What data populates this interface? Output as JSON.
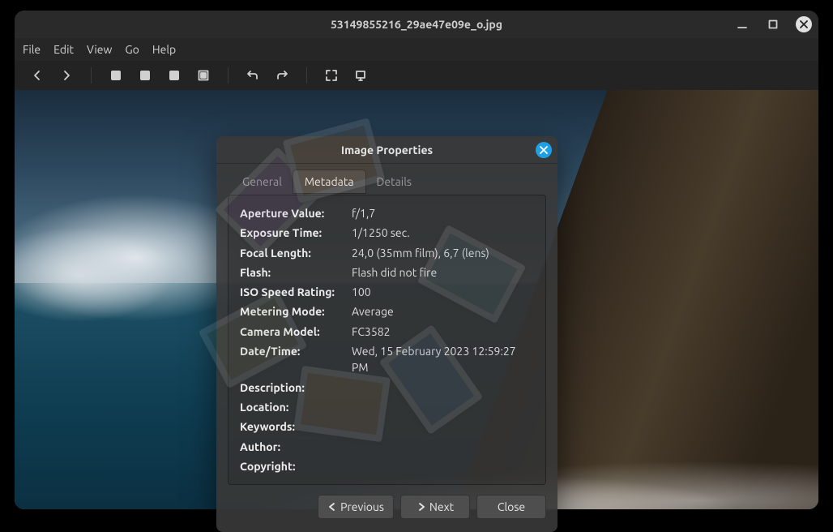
{
  "window": {
    "title": "53149855216_29ae47e09e_o.jpg"
  },
  "menu": {
    "file": "File",
    "edit": "Edit",
    "view": "View",
    "go": "Go",
    "help": "Help"
  },
  "dialog": {
    "title": "Image Properties",
    "tabs": {
      "general": "General",
      "metadata": "Metadata",
      "details": "Details"
    },
    "metadata": [
      {
        "label": "Aperture Value:",
        "value": "f/1,7"
      },
      {
        "label": "Exposure Time:",
        "value": "1/1250 sec."
      },
      {
        "label": "Focal Length:",
        "value": "24,0 (35mm film), 6,7 (lens)"
      },
      {
        "label": "Flash:",
        "value": "Flash did not fire"
      },
      {
        "label": "ISO Speed Rating:",
        "value": "100"
      },
      {
        "label": "Metering Mode:",
        "value": "Average"
      },
      {
        "label": "Camera Model:",
        "value": "FC3582"
      },
      {
        "label": "Date/Time:",
        "value": "Wed, 15 February 2023  12:59:27 PM"
      },
      {
        "label": "Description:",
        "value": ""
      },
      {
        "label": "Location:",
        "value": ""
      },
      {
        "label": "Keywords:",
        "value": ""
      },
      {
        "label": "Author:",
        "value": ""
      },
      {
        "label": "Copyright:",
        "value": ""
      }
    ],
    "buttons": {
      "previous": "Previous",
      "next": "Next",
      "close": "Close"
    }
  }
}
